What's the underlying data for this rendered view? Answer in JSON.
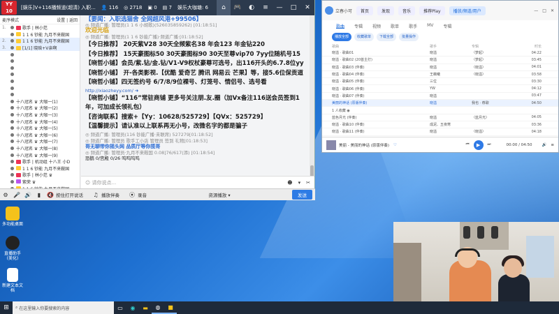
{
  "chat": {
    "logo_text": "YY 10",
    "window_title": "[娱乐]V+116播频道(超清) 入职...",
    "stats": [
      "116",
      "2718",
      "0",
      "7"
    ],
    "streamer_info": "娱乐大咖塘: 6",
    "userlist_header": {
      "left": "麦序模式",
      "right": "设置 | 返回"
    },
    "users": [
      {
        "no": "1.",
        "name": "歌手 | 林小范",
        "sel": false,
        "badge": "#e35"
      },
      {
        "no": "",
        "name": "1 1 6 钞能 九月不来鞍国",
        "sel": false,
        "badge": "#fc3"
      },
      {
        "no": "2.",
        "name": "1 1 6 钞能 九月不来鞍国",
        "sel": true,
        "badge": "#fc3"
      },
      {
        "no": "3.",
        "name": "[1/1] 晓晗+V亲啊",
        "sel": true,
        "badge": "#fc3"
      },
      {
        "no": "",
        "name": "",
        "sel": false,
        "badge": ""
      },
      {
        "no": "",
        "name": "",
        "sel": false,
        "badge": ""
      },
      {
        "no": "",
        "name": "",
        "sel": false,
        "badge": ""
      },
      {
        "no": "",
        "name": "",
        "sel": false,
        "badge": ""
      },
      {
        "no": "",
        "name": "",
        "sel": false,
        "badge": ""
      },
      {
        "no": "",
        "name": "",
        "sel": false,
        "badge": ""
      },
      {
        "no": "",
        "name": "",
        "sel": false,
        "badge": ""
      },
      {
        "no": "",
        "name": "十八冠名 ♛ 大咖一(1)",
        "sel": false,
        "badge": ""
      },
      {
        "no": "",
        "name": "十八冠名 ♛ 大咖一(2)",
        "sel": false,
        "badge": ""
      },
      {
        "no": "",
        "name": "十八冠名 ♛ 大咖一(3)",
        "sel": false,
        "badge": ""
      },
      {
        "no": "",
        "name": "十八冠名 ♛ 大咖一(4)",
        "sel": false,
        "badge": ""
      },
      {
        "no": "",
        "name": "十八冠名 ♛ 大咖一(5)",
        "sel": false,
        "badge": ""
      },
      {
        "no": "",
        "name": "十八冠名 ♛ 大咖一(6)",
        "sel": false,
        "badge": ""
      },
      {
        "no": "",
        "name": "十八冠名 ♛ 大咖一(7)",
        "sel": false,
        "badge": ""
      },
      {
        "no": "",
        "name": "十八冠名 ♛ 大咖一(8)",
        "sel": false,
        "badge": ""
      },
      {
        "no": "",
        "name": "十八冠名 ♛ 大咖一(9)",
        "sel": false,
        "badge": ""
      },
      {
        "no": "",
        "name": "歌手 | 机动组 十八王 小D",
        "sel": false,
        "badge": "#e35"
      },
      {
        "no": "",
        "name": "1 1 6 钞能 九月不来鞍国",
        "sel": false,
        "badge": "#fc3"
      },
      {
        "no": "",
        "name": "歌手 | 林小范 ♛",
        "sel": false,
        "badge": "#e35"
      },
      {
        "no": "",
        "name": "紫荣 ♛",
        "sel": false,
        "badge": "#b5e"
      },
      {
        "no": "",
        "name": "1 1 6 钞能 九月不来鞍国",
        "sel": false,
        "badge": "#fc3"
      },
      {
        "no": "",
        "name": "十八冠名 ♛ 大咖一",
        "sel": false,
        "badge": ""
      },
      {
        "no": "",
        "name": "十八冠名 ♛ 大咖一",
        "sel": false,
        "badge": ""
      },
      {
        "no": "",
        "name": "十八冠名 ♛ 大咖一",
        "sel": false,
        "badge": ""
      },
      {
        "no": "",
        "name": "十八冠名 ♛ 大咖一",
        "sel": false,
        "badge": ""
      },
      {
        "no": "",
        "name": "十八冠名 ♛ 大咖一",
        "sel": false,
        "badge": ""
      }
    ],
    "messages": {
      "m1_title": "【要闻：入职选猫舍 全网超风港+99506】",
      "m1_head": "◎ 频道广播: 管理员(1 1 6 小胡歌)(526035859262) [01:18:51]",
      "m1_sub": "欢迎光临",
      "m2_head": "◎ 频道广播: 管理员(1 1 6 钞能广播)·频道广播·[01:18:52]",
      "big": [
        "【今日推荐】 20天紫V28  30天全频紫名38  年会123  年金钻220",
        "【今日推荐】 15天豪图标50  30天豪图标90   30天至尊vip70 7yy位随机号15",
        "【晓哲小铺】会员/紫.钻/金.钻/V1-V9权杖豪尊可选号，出116开头的6.7.8位yy",
        "【晓哲小铺】 开-各类影视.【优酷 爱奇艺 腾讯 网易云 芒果】等，接5.6位保贡道",
        "【晓哲小铺】四无签约号 6/7/8/9位裸号、灯笼号、情侣号、选号看"
      ],
      "link": "http://xiaozheyy.com/",
      "big2": [
        "【晓哲小铺】“116”常驻商铺 更多号关注朋.友.圈（加Vx备注116送会员签到1",
        "年，可加成长领礼包）",
        "【咨询联系】搜索+【Yy：10628/525729】【QVx：525729】",
        "【温馨提示】请认准以上联系再无小号，改微名字的都是骗子"
      ],
      "m3_head": "◎ 频道广播: 管理员(116 钞能广播·未联席) 527279[01:18:52]",
      "m4_head": "◎ 频道广播: 管理员 歌手工小店 管理员 签到 礼物[01:18:53]",
      "m4_text": "哥无聊带你摇头网 品质厅等你揽哥",
      "m5_head": "◎ 频道广播: 管理员·九月不来鞍国 0.08]76/617(添) [01:18:54]",
      "m5_text": "恐鹅 0/宫殿 0/26  呜呜呜呜"
    },
    "input_placeholder": "请你说点...",
    "bottom": {
      "mic": "按住打开说话",
      "play": "播放伴奏",
      "record": "录音",
      "resource": "资源播放 ▾",
      "send": "发送"
    }
  },
  "music": {
    "user": "立春小可",
    "tabs": [
      "首页",
      "发现",
      "音乐",
      "推荐Play",
      "播放/频道/用户"
    ],
    "nav": [
      "歌曲",
      "专辑",
      "视频",
      "歌单",
      "歌手",
      "MV",
      "专辑"
    ],
    "buttons": [
      "播放全部",
      "收藏歌单",
      "下载全部",
      "批量操作"
    ],
    "headers": [
      "歌曲",
      "歌手",
      "专辑",
      "时长"
    ],
    "rows": [
      {
        "t": "晓溢 · 歌曲01",
        "a": "晓溢",
        "b": "〈梦起〉",
        "d": "04:22",
        "hl": false
      },
      {
        "t": "晓溢 · 歌曲02 (20首主打)",
        "a": "晓溢",
        "b": "〈梦起〉",
        "d": "03:45",
        "hl": false
      },
      {
        "t": "晓溢 · 歌曲03 (伴奏)",
        "a": "晓溢",
        "b": "〈晓溢〉",
        "d": "04:01",
        "hl": false
      },
      {
        "t": "晓溢 · 歌曲04 (伴奏)",
        "a": "王薇曦",
        "b": "〈晓溢〉",
        "d": "03:58",
        "hl": false
      },
      {
        "t": "晓溢 · 歌曲05 (伴奏)",
        "a": "三位",
        "b": "",
        "d": "03:30",
        "hl": false
      },
      {
        "t": "晓溢 · 歌曲06 (伴奏)",
        "a": "YW",
        "b": "",
        "d": "04:12",
        "hl": false
      },
      {
        "t": "晓溢 · 歌曲07 (伴奏)",
        "a": "晓溢",
        "b": "",
        "d": "03:47",
        "hl": false
      },
      {
        "t": "美丽的神话 (原版伴奏)",
        "a": "晓溢",
        "b": "我也 · 荐歌",
        "d": "04:50",
        "hl": true
      },
      {
        "t": "1 人收藏 ◉",
        "a": "",
        "b": "",
        "d": "",
        "hl": false
      },
      {
        "t": "蓝色月光 (伴奏)",
        "a": "晓溢",
        "b": "〈蓝月光〉",
        "d": "04:05",
        "hl": false
      },
      {
        "t": "晓溢 · 歌曲10 (伴奏)",
        "a": "成泥、五夜寒",
        "b": "",
        "d": "03:36",
        "hl": false
      },
      {
        "t": "晓溢 · 歌曲11 (伴奏)",
        "a": "晓溢",
        "b": "〈晓溢〉",
        "d": "04:18",
        "hl": false
      },
      {
        "t": "晓溢 · 歌曲12 (伴奏)",
        "a": "五牛出",
        "b": "",
        "d": "03:52",
        "hl": false
      }
    ],
    "player": {
      "song": "美丽 - 美丽的神话 (原版伴奏)",
      "time": "00:00 / 04:50"
    }
  },
  "desktop_icons": [
    "多功能桌面",
    "直播助手 (美化)",
    "新建文本文档"
  ],
  "taskbar": {
    "search": "在这里输入你要搜索的内容"
  }
}
